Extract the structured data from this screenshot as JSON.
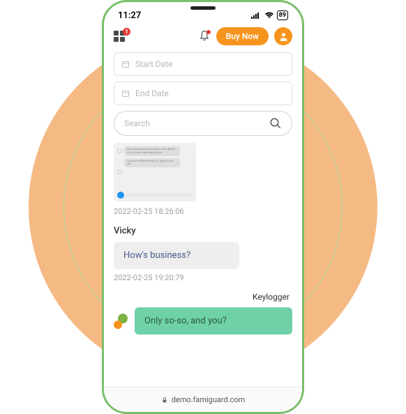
{
  "status": {
    "time": "11:27",
    "battery": "89"
  },
  "header": {
    "menu_badge": "1",
    "buy_label": "Buy Now"
  },
  "filters": {
    "start_placeholder": "Start Date",
    "end_placeholder": "End Date",
    "search_placeholder": "Search"
  },
  "thumb": {
    "line1": "Not my family's away and I can't afford to do much. what about you?",
    "line2": "I haven't decided what I'm going to do yet"
  },
  "conversation": {
    "screenshot_time": "2022-02-25 18:26:06",
    "sender": "Vicky",
    "incoming_msg": "How's business?",
    "incoming_time": "2022-02-25 19:20:79",
    "keylogger_label": "Keylogger",
    "outgoing_msg": "Only so-so, and you?"
  },
  "browser": {
    "domain": "demo.famiguard.com"
  }
}
